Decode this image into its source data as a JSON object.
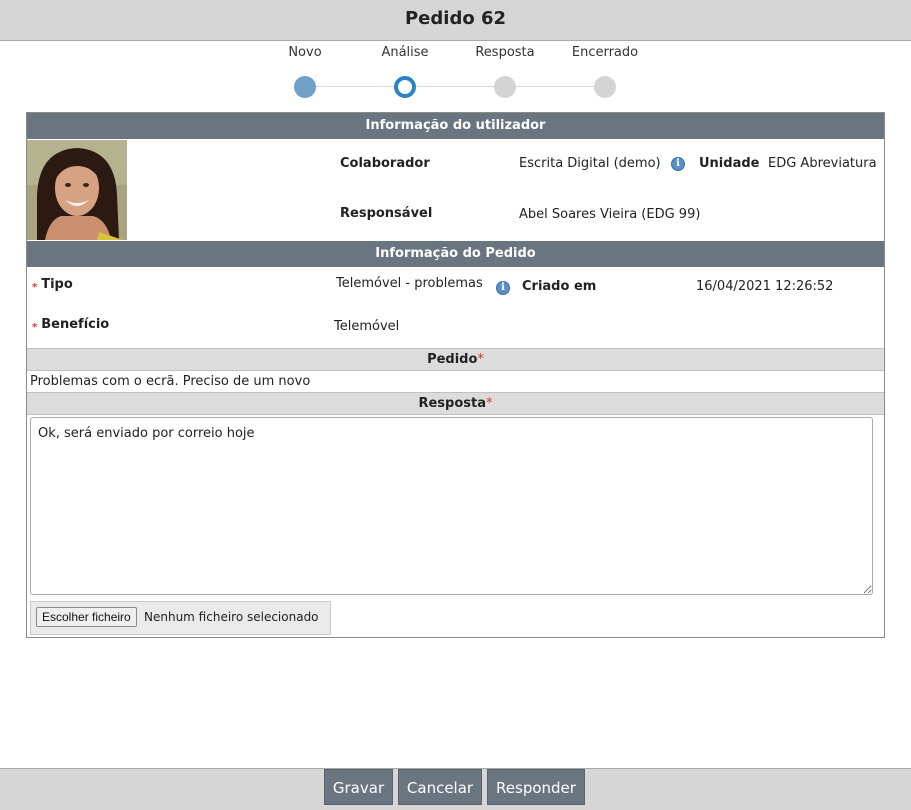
{
  "page": {
    "title": "Pedido 62"
  },
  "steps": [
    {
      "label": "Novo",
      "state": "done"
    },
    {
      "label": "Análise",
      "state": "current"
    },
    {
      "label": "Resposta",
      "state": "pending"
    },
    {
      "label": "Encerrado",
      "state": "pending"
    }
  ],
  "user_info": {
    "header": "Informação do utilizador",
    "collaborator_label": "Colaborador",
    "collaborator_value": "Escrita Digital (demo)",
    "unit_label": "Unidade",
    "unit_value": "EDG Abreviatura",
    "responsible_label": "Responsável",
    "responsible_value": "Abel Soares Vieira (EDG 99)"
  },
  "request_info": {
    "header": "Informação do Pedido",
    "type_label": "Tipo",
    "type_value": "Telemóvel - problemas",
    "created_label": "Criado em",
    "created_value": "16/04/2021 12:26:52",
    "benefit_label": "Benefício",
    "benefit_value": "Telemóvel"
  },
  "request": {
    "header": "Pedido",
    "text": "Problemas com o ecrã. Preciso de um novo"
  },
  "response": {
    "header": "Resposta",
    "text": "Ok, será enviado por correio hoje",
    "file_button": "Escolher ficheiro",
    "file_status": "Nenhum ficheiro selecionado"
  },
  "actions": {
    "save": "Gravar",
    "cancel": "Cancelar",
    "respond": "Responder"
  },
  "icons": {
    "info": "info-icon",
    "required": "required-asterisk-icon",
    "avatar": "user-photo"
  },
  "colors": {
    "header_bg": "#6b7580",
    "step_done": "#6fa1c8",
    "step_current": "#2a83c6",
    "required": "#d9342b"
  }
}
